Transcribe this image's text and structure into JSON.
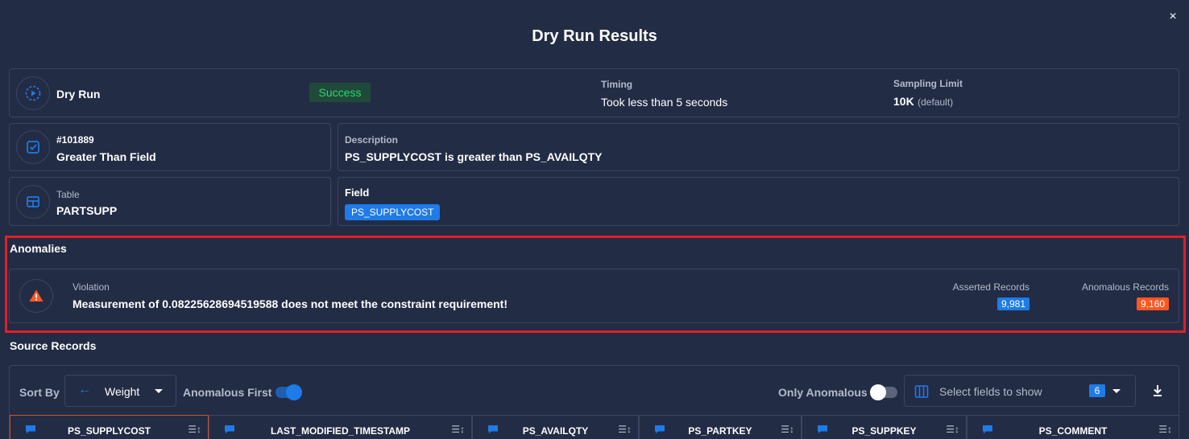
{
  "modal": {
    "title": "Dry Run Results",
    "close_icon": "×"
  },
  "dry_run": {
    "label": "Dry Run",
    "status": "Success",
    "timing_label": "Timing",
    "timing_value": "Took less than 5 seconds",
    "sampling_label": "Sampling Limit",
    "sampling_value": "10K",
    "sampling_suffix": "(default)"
  },
  "check": {
    "id": "#101889",
    "name": "Greater Than Field",
    "description_label": "Description",
    "description": "PS_SUPPLYCOST is greater than PS_AVAILQTY"
  },
  "table": {
    "label": "Table",
    "name": "PARTSUPP",
    "field_label": "Field",
    "field_value": "PS_SUPPLYCOST"
  },
  "anomalies": {
    "section_title": "Anomalies",
    "violation_label": "Violation",
    "violation_text": "Measurement of 0.08225628694519588 does not meet the constraint requirement!",
    "asserted_label": "Asserted Records",
    "asserted_count": "9,981",
    "anomalous_label": "Anomalous Records",
    "anomalous_count": "9,160"
  },
  "source": {
    "section_title": "Source Records",
    "sort_by_label": "Sort By",
    "sort_value": "Weight",
    "anomalous_first_label": "Anomalous First",
    "anomalous_first_on": true,
    "only_anomalous_label": "Only Anomalous",
    "only_anomalous_on": false,
    "fields_placeholder": "Select fields to show",
    "fields_count": "6",
    "columns": [
      "PS_SUPPLYCOST",
      "LAST_MODIFIED_TIMESTAMP",
      "PS_AVAILQTY",
      "PS_PARTKEY",
      "PS_SUPPKEY",
      "PS_COMMENT"
    ]
  },
  "colors": {
    "background": "#232c45",
    "accent": "#1e7be8",
    "success": "#2ed573",
    "danger": "#ff5722",
    "highlight_border": "#e41e26"
  }
}
